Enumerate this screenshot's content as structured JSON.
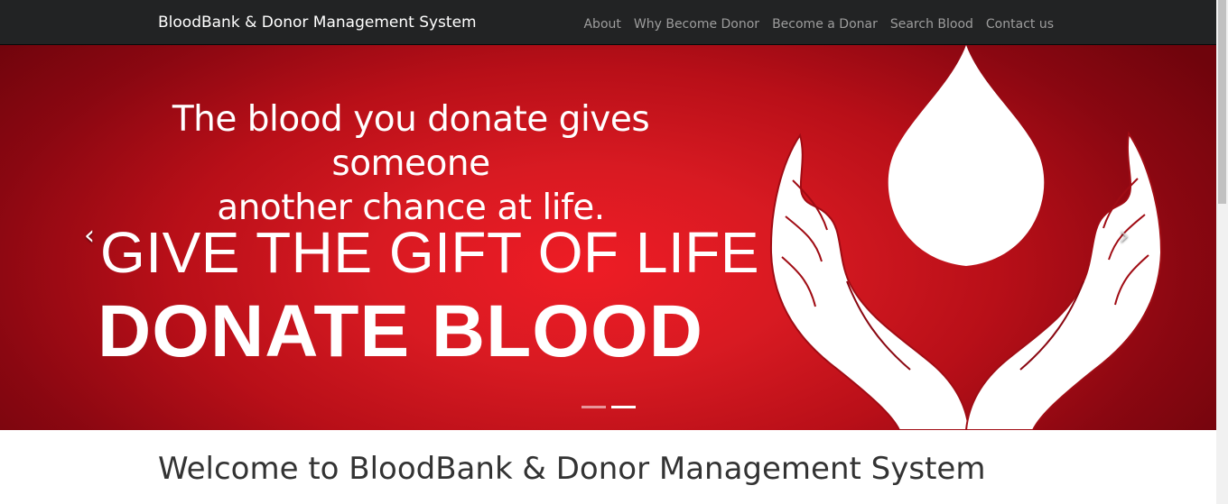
{
  "navbar": {
    "brand": "BloodBank & Donor Management System",
    "links": [
      {
        "label": "About"
      },
      {
        "label": "Why Become Donor"
      },
      {
        "label": "Become a Donar"
      },
      {
        "label": "Search Blood"
      },
      {
        "label": "Contact us"
      }
    ]
  },
  "carousel": {
    "tagline_line1": "The blood you donate gives someone",
    "tagline_line2": "another chance at life.",
    "headline": "GIVE THE GIFT OF LIFE",
    "cta": "DONATE BLOOD",
    "prev_icon": "chevron-left-icon",
    "next_icon": "chevron-right-icon",
    "prev_glyph": "‹",
    "next_glyph": "›",
    "slide_count": 2,
    "active_slide": 2
  },
  "main": {
    "heading": "Welcome to BloodBank & Donor Management System"
  },
  "colors": {
    "navbar_bg": "#222324",
    "brand_text": "#ffffff",
    "nav_link": "#9d9d9d",
    "banner_red": "#ee1c25",
    "banner_dark_red": "#6f040c",
    "heading_text": "#333333"
  }
}
